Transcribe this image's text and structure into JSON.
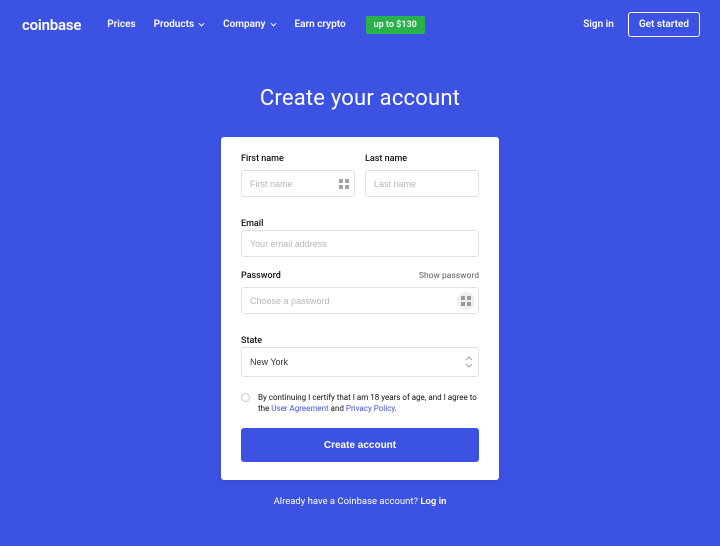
{
  "brand": "coinbase",
  "nav": {
    "prices": "Prices",
    "products": "Products",
    "company": "Company",
    "earn": "Earn crypto",
    "earn_badge": "up to $130",
    "signin": "Sign in",
    "get_started": "Get started"
  },
  "heading": "Create your account",
  "form": {
    "first_name_label": "First name",
    "first_name_placeholder": "First name",
    "last_name_label": "Last name",
    "last_name_placeholder": "Last name",
    "email_label": "Email",
    "email_placeholder": "Your email address",
    "password_label": "Password",
    "password_placeholder": "Choose a password",
    "show_password": "Show password",
    "state_label": "State",
    "state_value": "New York",
    "consent_prefix": "By continuing I certify that I am 18 years of age, and I agree to the ",
    "user_agreement": "User Agreement",
    "and": " and ",
    "privacy_policy": "Privacy Policy",
    "period": ".",
    "submit": "Create account"
  },
  "footer": {
    "already": "Already have a Coinbase account? ",
    "login": "Log in"
  }
}
